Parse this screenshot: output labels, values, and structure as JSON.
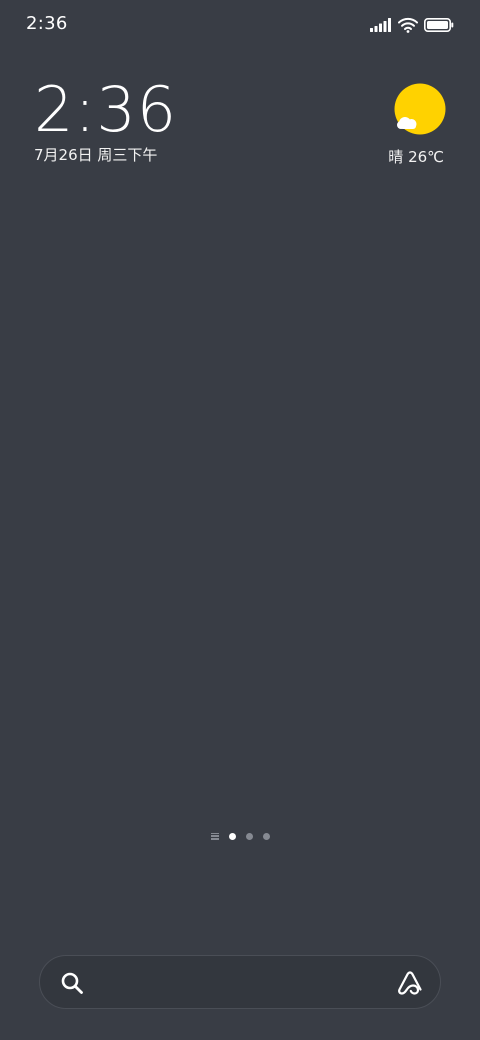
{
  "status_bar": {
    "time": "2:36",
    "icons": [
      "signal-icon",
      "wifi-icon",
      "battery-icon"
    ]
  },
  "clock_widget": {
    "time": "2:36",
    "date": "7月26日 周三下午"
  },
  "weather_widget": {
    "icon": "sun-cloud-icon",
    "text": "晴 26℃",
    "colors": {
      "sun": "#ffd200",
      "cloud": "#ffffff"
    }
  },
  "page_indicator": {
    "pages": 3,
    "active_index": 0,
    "icon": "menu-lines-icon"
  },
  "search_bar": {
    "left_icon": "search-icon",
    "right_icon": "assistant-icon",
    "placeholder": ""
  },
  "colors": {
    "background": "#393d45",
    "text": "#ffffff",
    "inactive_dot": "#868a92"
  }
}
